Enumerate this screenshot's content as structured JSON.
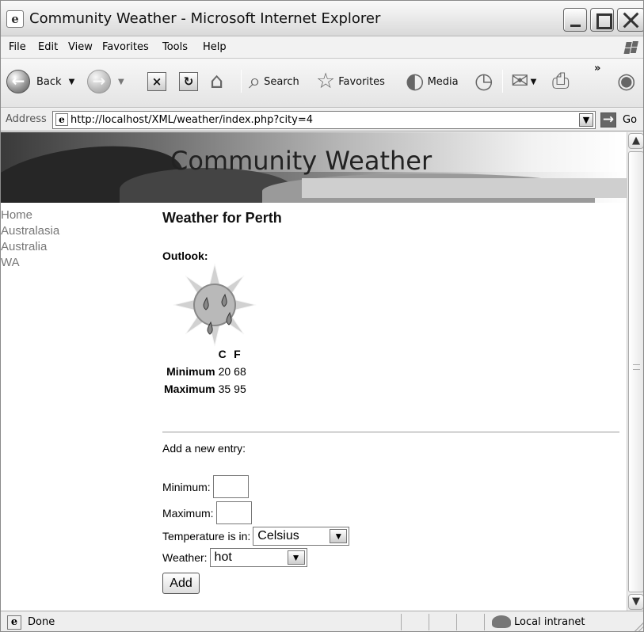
{
  "window": {
    "title": "Community Weather - Microsoft Internet Explorer",
    "icons": [
      "internet-explorer-icon",
      "minimize-icon",
      "maximize-icon",
      "close-icon"
    ]
  },
  "menu": [
    "File",
    "Edit",
    "View",
    "Favorites",
    "Tools",
    "Help"
  ],
  "toolbar": {
    "back_label": "Back",
    "search_label": "Search",
    "favorites_label": "Favorites",
    "media_label": "Media",
    "more_label": "»"
  },
  "address": {
    "label": "Address",
    "url": "http://localhost/XML/weather/index.php?city=4",
    "go_label": "Go"
  },
  "page": {
    "banner_title": "Community Weather",
    "nav": [
      "Home",
      "Australasia",
      "Australia",
      "WA"
    ],
    "title": "Weather for Perth",
    "outlook_label": "Outlook:",
    "temperature_headers": [
      "",
      "C",
      "F"
    ],
    "temperature_rows": [
      {
        "label": "Minimum",
        "c": "20",
        "f": "68"
      },
      {
        "label": "Maximum",
        "c": "35",
        "f": "95"
      }
    ],
    "add_entry_label": "Add a new entry:",
    "minimum_label": "Minimum:",
    "maximum_label": "Maximum:",
    "minimum_value": "",
    "maximum_value": "",
    "unit_label": "Temperature is in:",
    "unit_selected": "Celsius",
    "weather_label": "Weather:",
    "weather_selected": "hot",
    "add_button_label": "Add",
    "outlook_icon": "sun-with-rain-drops-icon"
  },
  "status": {
    "text": "Done",
    "zone": "Local intranet"
  }
}
